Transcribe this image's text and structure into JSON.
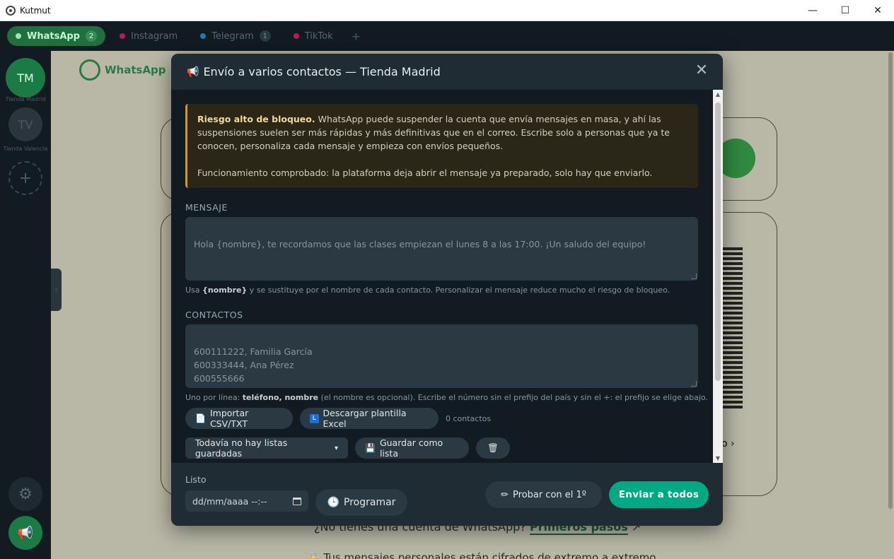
{
  "window": {
    "title": "Kutmut",
    "controls": {
      "minimize": "—",
      "maximize": "☐",
      "close": "✕"
    }
  },
  "tabs": [
    {
      "label": "WhatsApp",
      "badge": "2",
      "dot_color": "#9ee6b3",
      "active": true
    },
    {
      "label": "Instagram",
      "badge": "",
      "dot_color": "#c2185b",
      "active": false
    },
    {
      "label": "Telegram",
      "badge": "1",
      "dot_color": "#1f7ab8",
      "active": false
    },
    {
      "label": "TikTok",
      "badge": "",
      "dot_color": "#c2185b",
      "active": false
    }
  ],
  "tab_add": "+",
  "sidebar": {
    "accounts": [
      {
        "initials": "TM",
        "label": "Tienda Madrid",
        "color": "#1c7a45",
        "text_color": "#d8ffe4"
      },
      {
        "initials": "TV",
        "label": "Tienda Valencia",
        "color": "#2a353c",
        "text_color": "#4e5a63"
      }
    ],
    "add_icon": "+",
    "settings_icon": "⚙",
    "broadcast_icon": "📢"
  },
  "background": {
    "logo_text": "WhatsApp",
    "link_fragment": "o",
    "bottom_question": "¿No tienes una cuenta de WhatsApp?",
    "bottom_link": "Primeros pasos",
    "bottom_encrypted": "Tus mensajes personales están cifrados de extremo a extremo"
  },
  "modal": {
    "title": "Envío a varios contactos — Tienda Madrid",
    "title_icon": "📢",
    "close_icon": "✕",
    "warning": {
      "title": "Riesgo alto de bloqueo.",
      "body": " WhatsApp puede suspender la cuenta que envía mensajes en masa, y ahí las suspensiones suelen ser más rápidas y más definitivas que en el correo. Escribe solo a personas que ya te conocen, personaliza cada mensaje y empieza con envíos pequeños.",
      "note": "Funcionamiento comprobado: la plataforma deja abrir el mensaje ya preparado, solo hay que enviarlo."
    },
    "message": {
      "label": "MENSAJE",
      "placeholder": "Hola {nombre}, te recordamos que las clases empiezan el lunes 8 a las 17:00. ¡Un saludo del equipo!",
      "hint_pre": "Usa ",
      "hint_bold": "{nombre}",
      "hint_post": " y se sustituye por el nombre de cada contacto. Personalizar el mensaje reduce mucho el riesgo de bloqueo."
    },
    "contacts": {
      "label": "CONTACTOS",
      "placeholder": "600111222, Familia García\n600333444, Ana Pérez\n600555666",
      "hint_pre": "Uno por línea: ",
      "hint_bold": "teléfono, nombre",
      "hint_post": " (el nombre es opcional). Escribe el número sin el prefijo del país y sin el +: el prefijo se elige abajo.",
      "import_label": "Importar CSV/TXT",
      "import_icon": "📄",
      "template_label": "Descargar plantilla Excel",
      "template_icon": "L",
      "count": "0 contactos",
      "lists_selected": "Todavía no hay listas guardadas",
      "save_list_label": "Guardar como lista",
      "save_list_icon": "💾",
      "delete_icon": "🗑"
    },
    "footer": {
      "status": "Listo",
      "datetime_placeholder": "dd/mm/aaaa --:--",
      "schedule_label": "Programar",
      "schedule_icon": "🕒",
      "test_label": "Probar con el 1º",
      "test_icon": "✏",
      "send_label": "Enviar a todos"
    }
  }
}
